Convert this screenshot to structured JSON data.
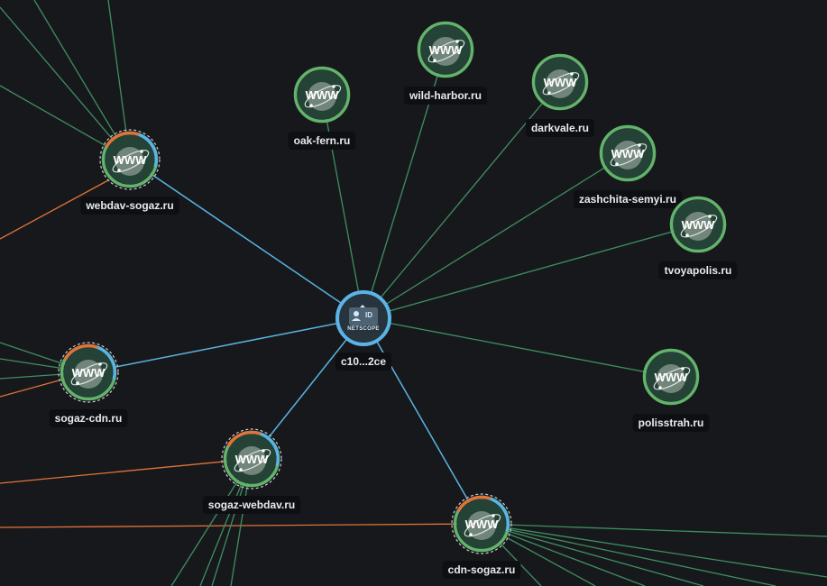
{
  "colors": {
    "background": "#17181b",
    "edge_green": "#3f8f62",
    "edge_blue": "#5ab4e5",
    "edge_orange": "#e0733a",
    "node_ring_green": "#62b36b",
    "node_fill": "#244236",
    "center_ring": "#5ab4e5",
    "center_fill": "#27333d",
    "label_bg": "#0e0f12",
    "label_text": "#e8eaed"
  },
  "center_node": {
    "icon": "id-card-icon",
    "badge": "ID",
    "caption": "NETSCOPE",
    "label": "c10...2ce"
  },
  "domain_nodes": [
    {
      "id": "webdav",
      "label": "webdav-sogaz.ru",
      "icon": "globe-icon",
      "icon_text": "WWW",
      "flagged": true
    },
    {
      "id": "oakfern",
      "label": "oak-fern.ru",
      "icon": "globe-icon",
      "icon_text": "WWW",
      "flagged": false
    },
    {
      "id": "wildharbor",
      "label": "wild-harbor.ru",
      "icon": "globe-icon",
      "icon_text": "WWW",
      "flagged": false
    },
    {
      "id": "darkvale",
      "label": "darkvale.ru",
      "icon": "globe-icon",
      "icon_text": "WWW",
      "flagged": false
    },
    {
      "id": "zashchita",
      "label": "zashchita-semyi.ru",
      "icon": "globe-icon",
      "icon_text": "WWW",
      "flagged": false
    },
    {
      "id": "tvoyapolis",
      "label": "tvoyapolis.ru",
      "icon": "globe-icon",
      "icon_text": "WWW",
      "flagged": false
    },
    {
      "id": "polisstrah",
      "label": "polisstrah.ru",
      "icon": "globe-icon",
      "icon_text": "WWW",
      "flagged": false
    },
    {
      "id": "sogazcdn",
      "label": "sogaz-cdn.ru",
      "icon": "globe-icon",
      "icon_text": "WWW",
      "flagged": true
    },
    {
      "id": "sogazwebdav",
      "label": "sogaz-webdav.ru",
      "icon": "globe-icon",
      "icon_text": "WWW",
      "flagged": true
    },
    {
      "id": "cdnsogaz",
      "label": "cdn-sogaz.ru",
      "icon": "globe-icon",
      "icon_text": "WWW",
      "flagged": true
    }
  ]
}
